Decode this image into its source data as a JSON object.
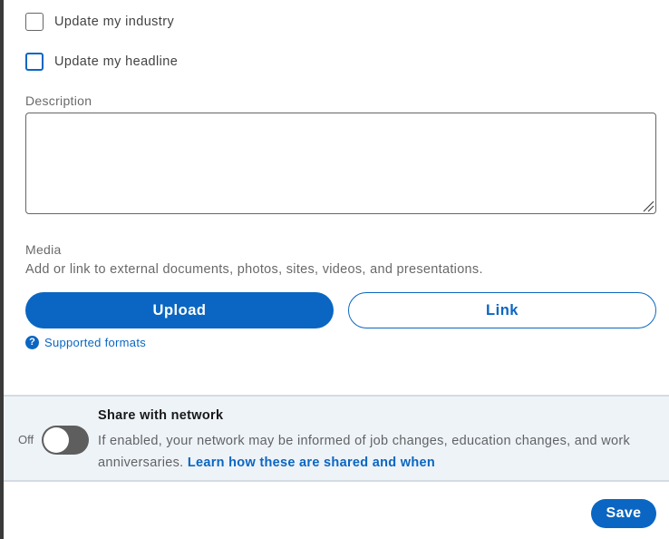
{
  "checkboxes": [
    {
      "label": "Update my industry",
      "checked": false
    },
    {
      "label": "Update my headline",
      "checked": false
    }
  ],
  "description": {
    "label": "Description",
    "value": ""
  },
  "media": {
    "label": "Media",
    "help_text": "Add or link to external documents, photos, sites, videos, and presentations.",
    "upload_label": "Upload",
    "link_label": "Link",
    "formats_icon": "question-circle-icon",
    "formats_label": "Supported formats"
  },
  "share": {
    "toggle_state_label": "Off",
    "toggle_on": false,
    "title": "Share with network",
    "body": "If enabled, your network may be informed of job changes, education changes, and work anniversaries.",
    "learn_more": "Learn how these are shared and when"
  },
  "footer": {
    "save_label": "Save"
  },
  "colors": {
    "accent": "#0a66c2",
    "panel_bg": "#eef3f8",
    "toggle_off": "#5e5e5e"
  }
}
